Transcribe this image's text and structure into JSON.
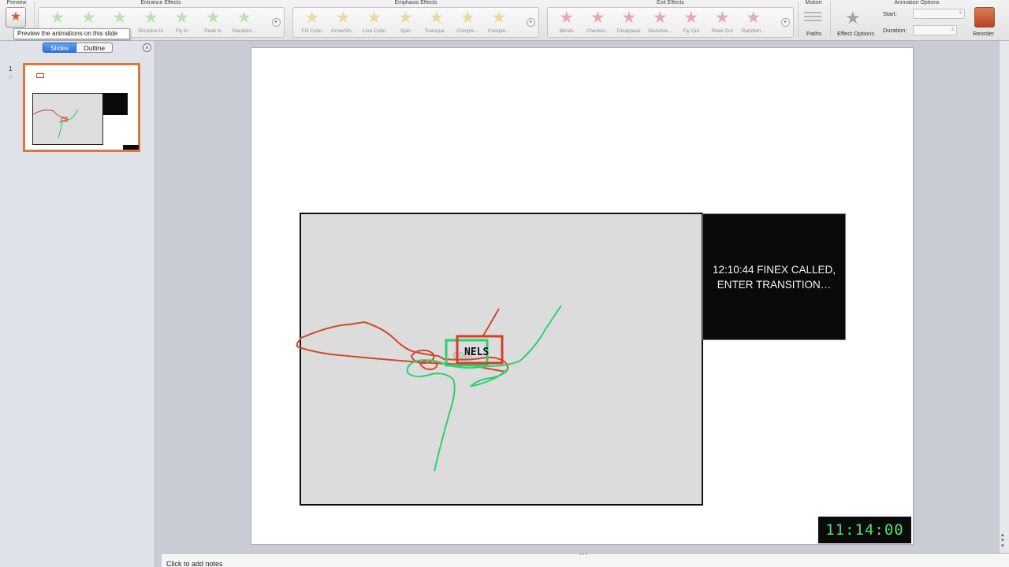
{
  "ribbon": {
    "preview_group": "Preview",
    "tooltip": "Preview the animations on this slide",
    "entrance": {
      "title": "Entrance Effects",
      "effects": [
        "",
        "",
        "",
        "Dissolve In",
        "Fly In",
        "Peek In",
        "Random..."
      ],
      "color": "#8fd17e"
    },
    "emphasis": {
      "title": "Emphasis Effects",
      "effects": [
        "Fill Color",
        "Grow/Sh...",
        "Line Color",
        "Spin",
        "Transpar...",
        "Comple...",
        "Comple..."
      ],
      "color": "#e6c35a"
    },
    "exit": {
      "title": "Exit Effects",
      "effects": [
        "Blinds",
        "Checker...",
        "Disappear",
        "Dissolve...",
        "Fly Out",
        "Peek Out",
        "Random..."
      ],
      "color": "#e06b7a"
    },
    "motion": {
      "title": "Motion",
      "paths_label": "Paths"
    },
    "options": {
      "title": "Animation Options",
      "effect_options_label": "Effect Options",
      "start_label": "Start:",
      "duration_label": "Duration:",
      "reorder_label": "Reorder"
    }
  },
  "left_panel": {
    "tabs": [
      "Slides",
      "Outline"
    ],
    "active_tab": "Slides",
    "slide_number": "1"
  },
  "slide": {
    "caption": "12:10:44 FINEX CALLED, ENTER TRANSITION…",
    "clock": "11:14:00",
    "nels_label": "NELS",
    "ghost_label": "COOL"
  },
  "notes": {
    "placeholder": "Click to add notes"
  }
}
